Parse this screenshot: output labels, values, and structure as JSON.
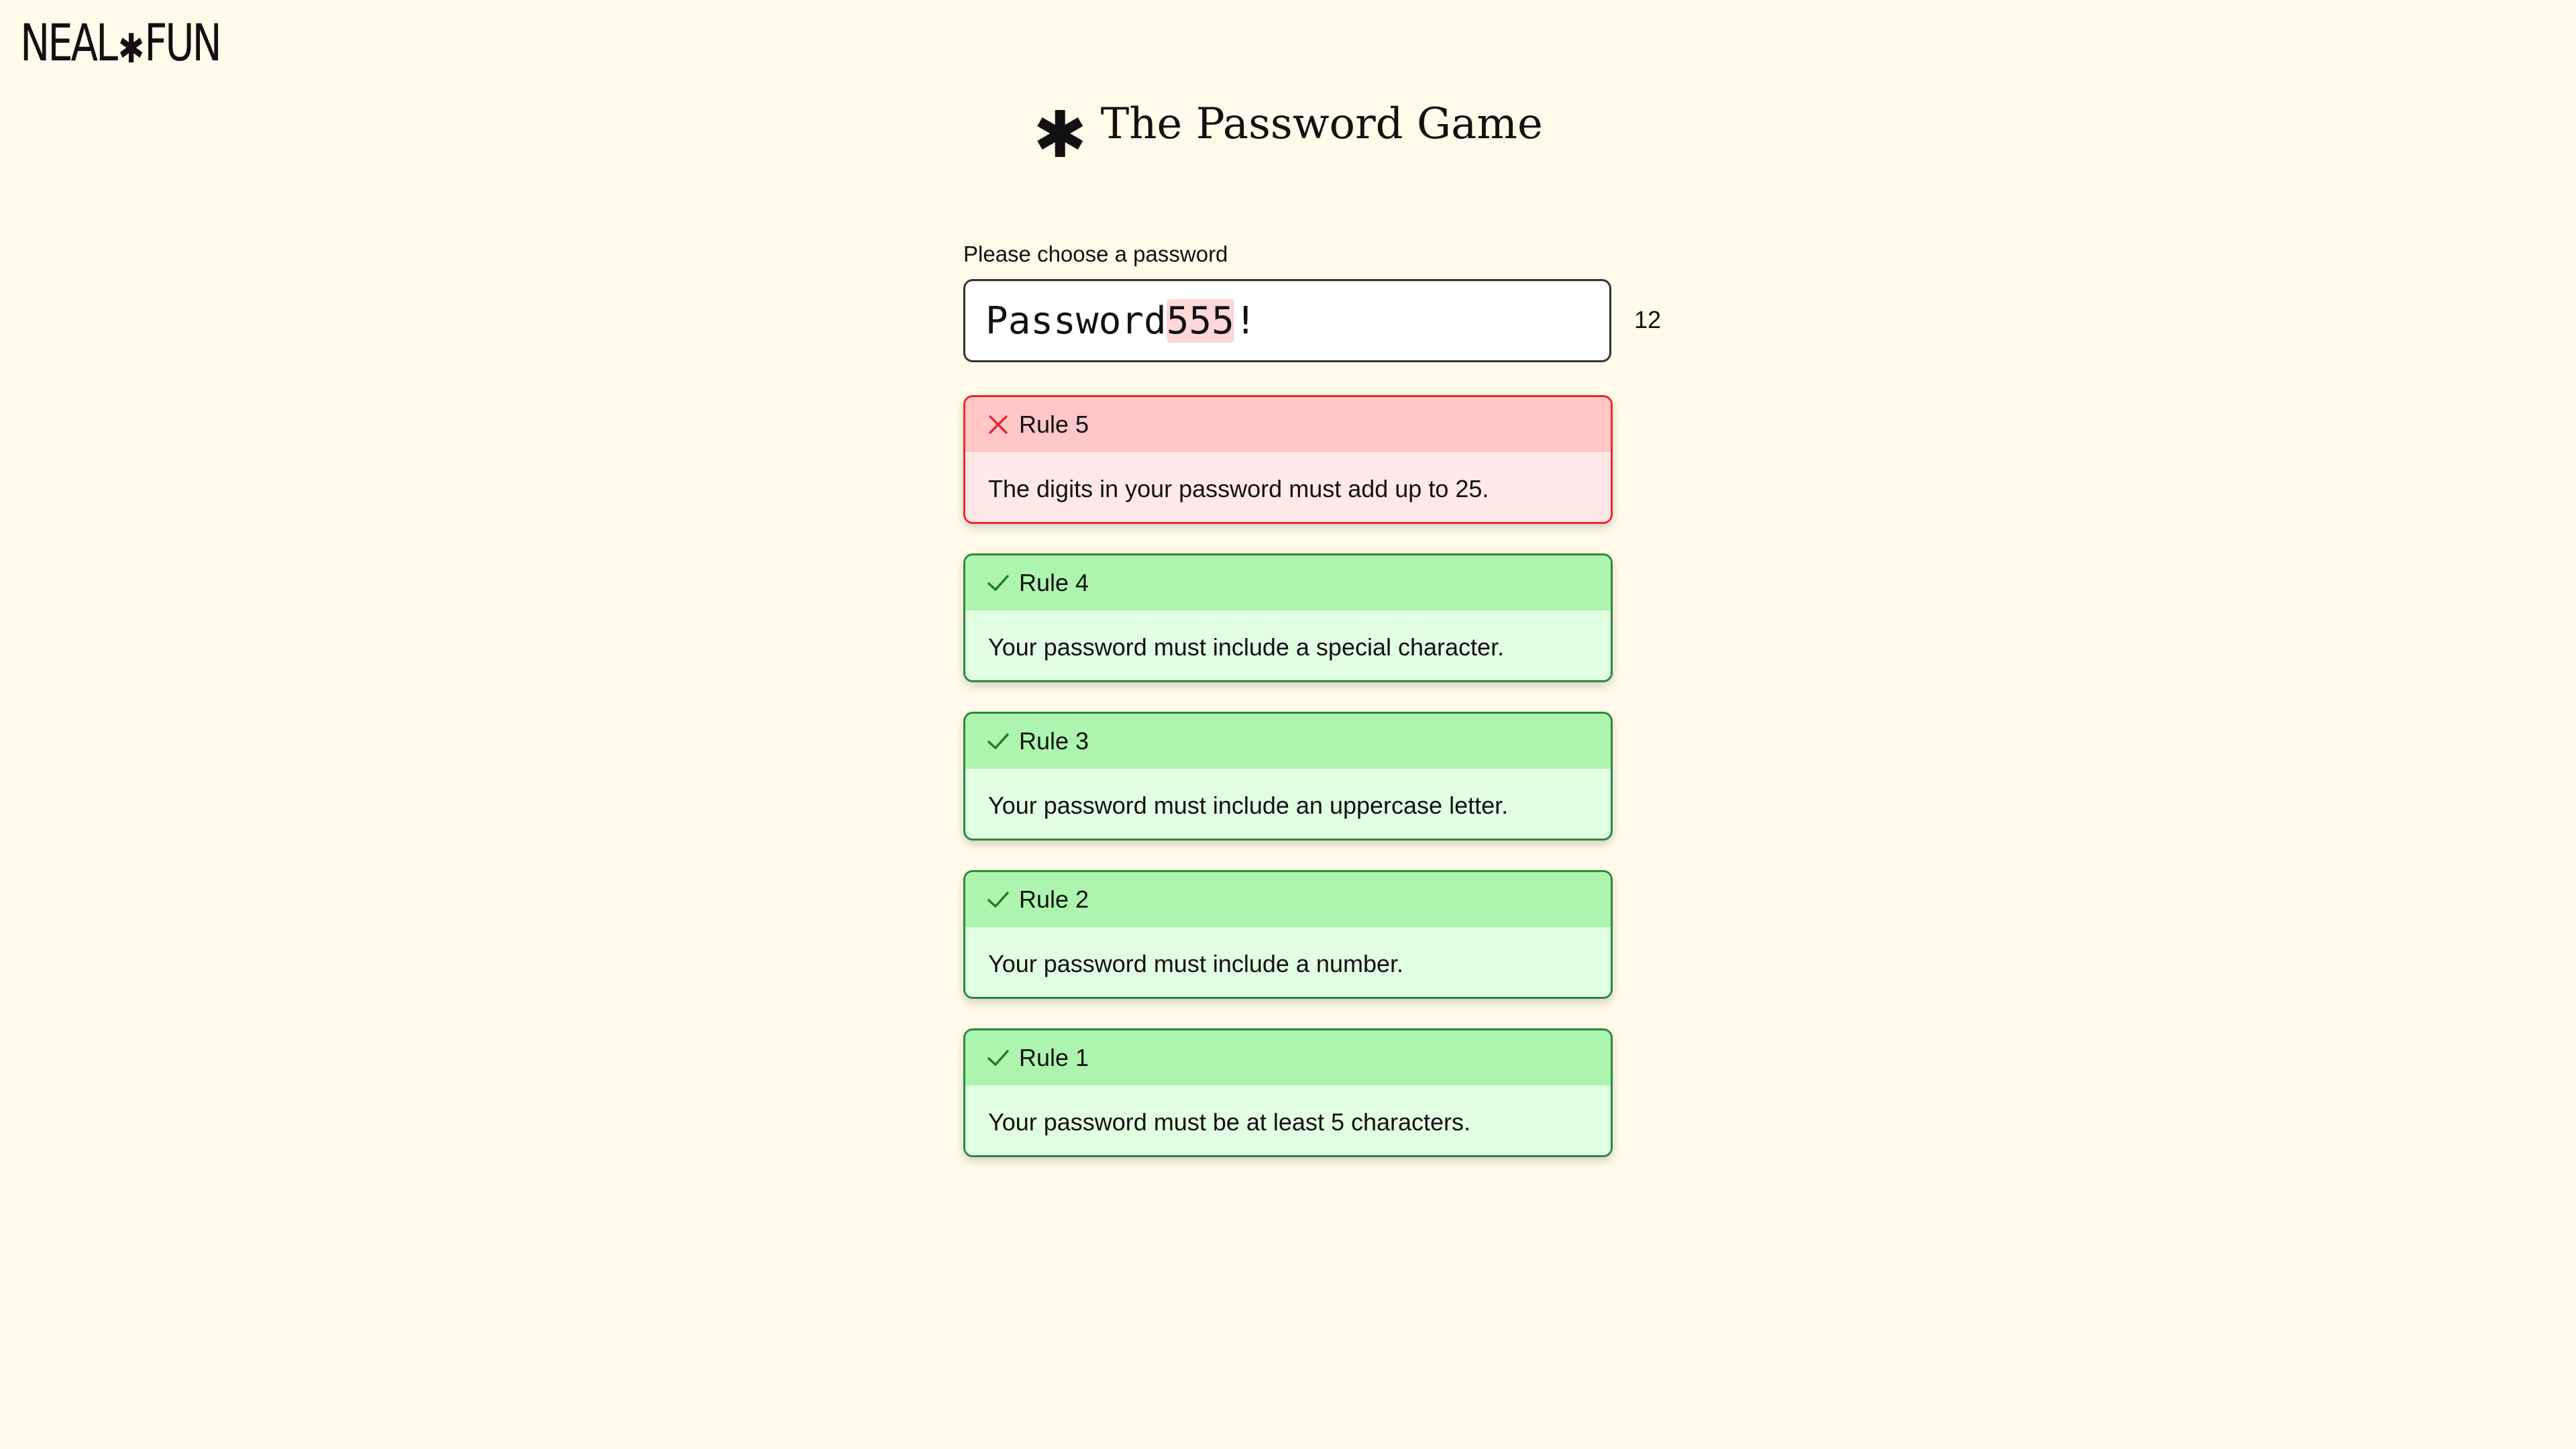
{
  "brand": {
    "logo_left": "NEAL",
    "logo_star": "✱",
    "logo_right": "FUN"
  },
  "page": {
    "title_icon": "✱",
    "title": "The Password Game"
  },
  "password": {
    "label": "Please choose a password",
    "prefix": "Password",
    "digits": "555",
    "suffix": "!",
    "length": "12"
  },
  "rules": [
    {
      "status": "fail",
      "title": "Rule 5",
      "text": "The digits in your password must add up to 25."
    },
    {
      "status": "pass",
      "title": "Rule 4",
      "text": "Your password must include a special character."
    },
    {
      "status": "pass",
      "title": "Rule 3",
      "text": "Your password must include an uppercase letter."
    },
    {
      "status": "pass",
      "title": "Rule 2",
      "text": "Your password must include a number."
    },
    {
      "status": "pass",
      "title": "Rule 1",
      "text": "Your password must be at least 5 characters."
    }
  ],
  "icons": {
    "fail": "close-x-icon",
    "pass": "checkmark-icon"
  },
  "colors": {
    "background": "#fffae9",
    "fail_border": "#e62a2a",
    "fail_header": "#ffc7c7",
    "fail_body": "#ffe8e8",
    "pass_border": "#2a8a3d",
    "pass_header": "#adf5ae",
    "pass_body": "#e2fee2",
    "digit_highlight": "#ffd7d7"
  }
}
